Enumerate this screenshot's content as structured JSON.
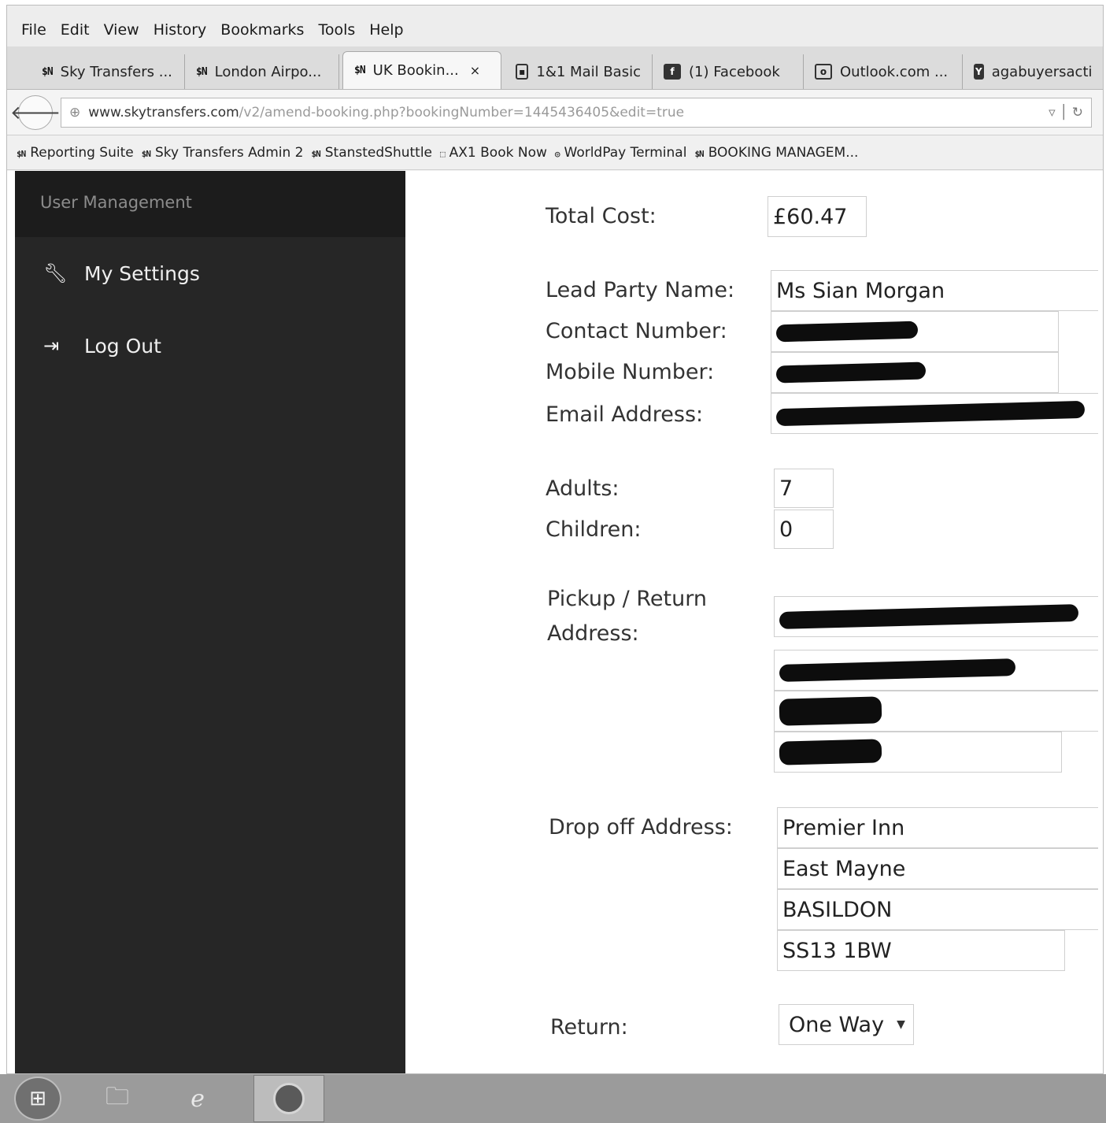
{
  "menu": [
    "File",
    "Edit",
    "View",
    "History",
    "Bookmarks",
    "Tools",
    "Help"
  ],
  "tabs": [
    {
      "label": "Sky Transfers ...",
      "icon": "stn-logo-icon"
    },
    {
      "label": "London Airpo...",
      "icon": "stn-logo-icon"
    },
    {
      "label": "UK Bookin...",
      "icon": "stn-logo-icon",
      "active": true
    },
    {
      "label": "1&1 Mail Basic",
      "icon": "mail-icon"
    },
    {
      "label": "(1) Facebook",
      "icon": "facebook-icon"
    },
    {
      "label": "Outlook.com ...",
      "icon": "outlook-icon"
    },
    {
      "label": "agabuyersacti",
      "icon": "yahoo-icon"
    }
  ],
  "tab_close": "×",
  "address": {
    "domain": "www.skytransfers.com",
    "path": "/v2/amend-booking.php?bookingNumber=1445436405&edit=true"
  },
  "bookmarks": [
    {
      "label": "Reporting Suite",
      "icon": "stn-logo-icon"
    },
    {
      "label": "Sky Transfers Admin 2",
      "icon": "stn-logo-icon"
    },
    {
      "label": "StanstedShuttle",
      "icon": "stn-logo-icon"
    },
    {
      "label": "AX1 Book Now",
      "icon": "page-icon"
    },
    {
      "label": "WorldPay Terminal",
      "icon": "worldpay-icon"
    },
    {
      "label": "BOOKING MANAGEM...",
      "icon": "stn-logo-icon"
    }
  ],
  "sidebar": {
    "header": "User Management",
    "items": [
      {
        "label": "My Settings",
        "icon": "wrench-icon"
      },
      {
        "label": "Log Out",
        "icon": "logout-icon"
      }
    ]
  },
  "form": {
    "total_cost_label": "Total Cost:",
    "total_cost_value": "£60.47",
    "lead_party_label": "Lead Party Name:",
    "lead_party_value": "Ms Sian Morgan",
    "contact_label": "Contact Number:",
    "mobile_label": "Mobile Number:",
    "email_label": "Email Address:",
    "adults_label": "Adults:",
    "adults_value": "7",
    "children_label": "Children:",
    "children_value": "0",
    "pickup_label_line1": "Pickup / Return",
    "pickup_label_line2": "Address:",
    "dropoff_label": "Drop off Address:",
    "dropoff_lines": [
      "Premier Inn",
      "East Mayne",
      "BASILDON",
      "SS13 1BW"
    ],
    "return_label": "Return:",
    "return_value": "One Way"
  }
}
